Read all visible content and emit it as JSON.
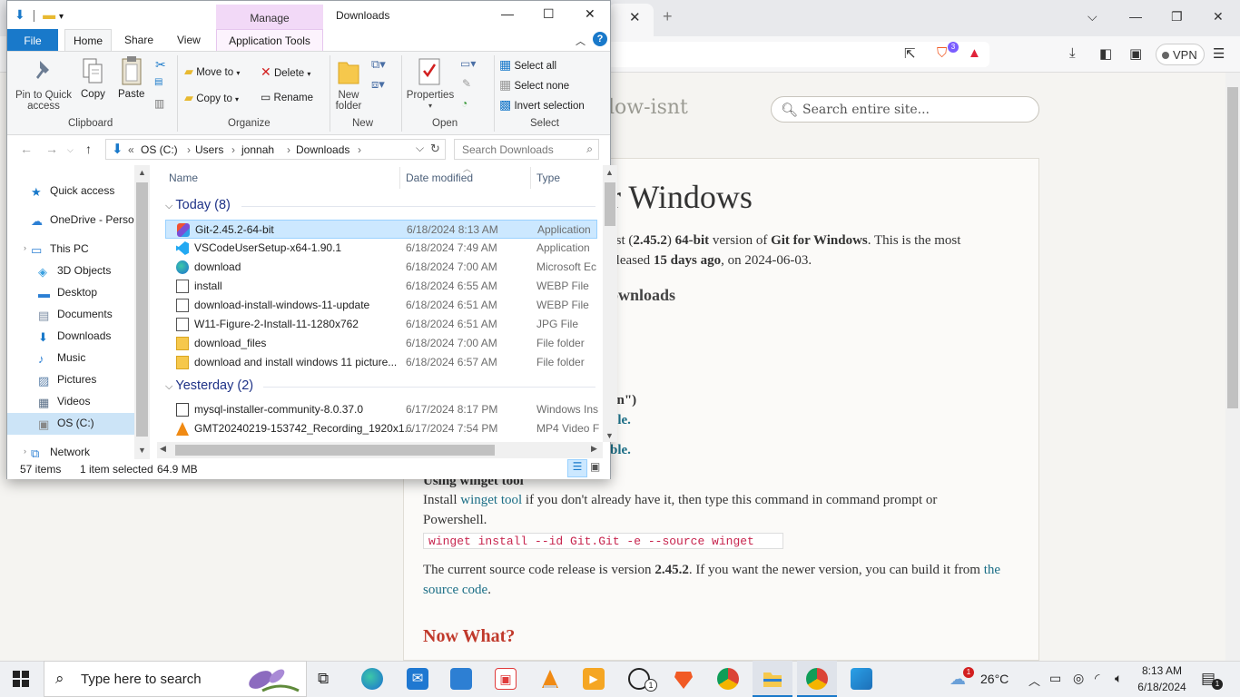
{
  "browser": {
    "tab_close": "✕",
    "new_tab": "+",
    "vpn_label": "VPN",
    "brave_badge": "3",
    "site_name": "low-isnt",
    "site_search_placeholder": "Search entire site...",
    "page_title": "r Windows",
    "intro_line1_a": "est (",
    "intro_version": "2.45.2",
    "intro_line1_b": ") ",
    "intro_bits": "64-bit",
    "intro_line1_c": " version of ",
    "intro_product": "Git for Windows",
    "intro_line1_d": ". This is the most",
    "intro_line2_a": "eleased ",
    "intro_age": "15 days ago",
    "intro_line2_b": ", on 2024-06-03.",
    "downloads_heading": "ownloads",
    "frag_1": ".",
    "frag_2": ".",
    "frag_3": "on\")",
    "frag_4": "ble.",
    "frag_5": "ble.",
    "winget_heading": "Using winget tool",
    "winget_line1_a": "Install ",
    "winget_link": "winget tool",
    "winget_line1_b": " if you don't already have it, then type this command in command prompt or",
    "winget_line2": "Powershell.",
    "winget_command": "winget install --id Git.Git -e --source winget",
    "source_line1_a": "The current source code release is version ",
    "source_version": "2.45.2",
    "source_line1_b": ". If you want the newer version, you can build it from ",
    "source_link_a": "the",
    "source_link_b": "source code",
    "source_line2_end": ".",
    "now_what": "Now What?"
  },
  "explorer": {
    "title": "Downloads",
    "manage_label": "Manage",
    "tabs": {
      "file": "File",
      "home": "Home",
      "share": "Share",
      "view": "View",
      "app_tools": "Application Tools"
    },
    "ribbon": {
      "pin_label_1": "Pin to Quick",
      "pin_label_2": "access",
      "copy": "Copy",
      "paste": "Paste",
      "move_to": "Move to",
      "copy_to": "Copy to",
      "delete": "Delete",
      "rename": "Rename",
      "new_folder_1": "New",
      "new_folder_2": "folder",
      "properties": "Properties",
      "select_all": "Select all",
      "select_none": "Select none",
      "invert_selection": "Invert selection",
      "groups": {
        "clipboard": "Clipboard",
        "organize": "Organize",
        "new": "New",
        "open": "Open",
        "select": "Select"
      }
    },
    "address": {
      "prefix": "«",
      "crumbs": [
        "OS (C:)",
        "Users",
        "jonnah",
        "Downloads"
      ],
      "search_placeholder": "Search Downloads"
    },
    "nav": [
      {
        "label": "Quick access",
        "icon": "star-icon"
      },
      {
        "label": "OneDrive - Person",
        "icon": "cloud-icon"
      },
      {
        "label": "This PC",
        "icon": "monitor-icon"
      },
      {
        "label": "3D Objects",
        "icon": "cube-icon"
      },
      {
        "label": "Desktop",
        "icon": "desktop-icon"
      },
      {
        "label": "Documents",
        "icon": "document-icon"
      },
      {
        "label": "Downloads",
        "icon": "download-icon"
      },
      {
        "label": "Music",
        "icon": "music-icon"
      },
      {
        "label": "Pictures",
        "icon": "picture-icon"
      },
      {
        "label": "Videos",
        "icon": "video-icon"
      },
      {
        "label": "OS (C:)",
        "icon": "drive-icon"
      },
      {
        "label": "Network",
        "icon": "network-icon"
      }
    ],
    "columns": {
      "name": "Name",
      "date": "Date modified",
      "type": "Type"
    },
    "groups": [
      {
        "label": "Today (8)",
        "files": [
          {
            "name": "Git-2.45.2-64-bit",
            "date": "6/18/2024 8:13 AM",
            "type": "Application",
            "icon": "git-installer-icon",
            "selected": true
          },
          {
            "name": "VSCodeUserSetup-x64-1.90.1",
            "date": "6/18/2024 7:49 AM",
            "type": "Application",
            "icon": "vscode-icon"
          },
          {
            "name": "download",
            "date": "6/18/2024 7:00 AM",
            "type": "Microsoft Ec",
            "icon": "edge-icon"
          },
          {
            "name": "install",
            "date": "6/18/2024 6:55 AM",
            "type": "WEBP File",
            "icon": "image-file-icon"
          },
          {
            "name": "download-install-windows-11-update",
            "date": "6/18/2024 6:51 AM",
            "type": "WEBP File",
            "icon": "image-file-icon"
          },
          {
            "name": "W11-Figure-2-Install-11-1280x762",
            "date": "6/18/2024 6:51 AM",
            "type": "JPG File",
            "icon": "image-file-icon"
          },
          {
            "name": "download_files",
            "date": "6/18/2024 7:00 AM",
            "type": "File folder",
            "icon": "folder-icon"
          },
          {
            "name": "download and install windows 11 picture...",
            "date": "6/18/2024 6:57 AM",
            "type": "File folder",
            "icon": "folder-icon"
          }
        ]
      },
      {
        "label": "Yesterday (2)",
        "files": [
          {
            "name": "mysql-installer-community-8.0.37.0",
            "date": "6/17/2024 8:17 PM",
            "type": "Windows Ins",
            "icon": "msi-icon"
          },
          {
            "name": "GMT20240219-153742_Recording_1920x1...",
            "date": "6/17/2024 7:54 PM",
            "type": "MP4 Video F",
            "icon": "vlc-icon"
          }
        ]
      }
    ],
    "status": {
      "count": "57 items",
      "selected": "1 item selected",
      "size": "64.9 MB"
    }
  },
  "taskbar": {
    "search_placeholder": "Type here to search",
    "weather_temp": "26°C",
    "weather_badge": "1",
    "whatsapp_badge": "1",
    "time": "8:13 AM",
    "date": "6/18/2024",
    "notif_badge": "1"
  },
  "colors": {
    "accent": "#1979ca",
    "selection": "#cce8ff",
    "link": "#1b6e86",
    "heading_red": "#c0392b",
    "manage": "#f2d9f7"
  }
}
